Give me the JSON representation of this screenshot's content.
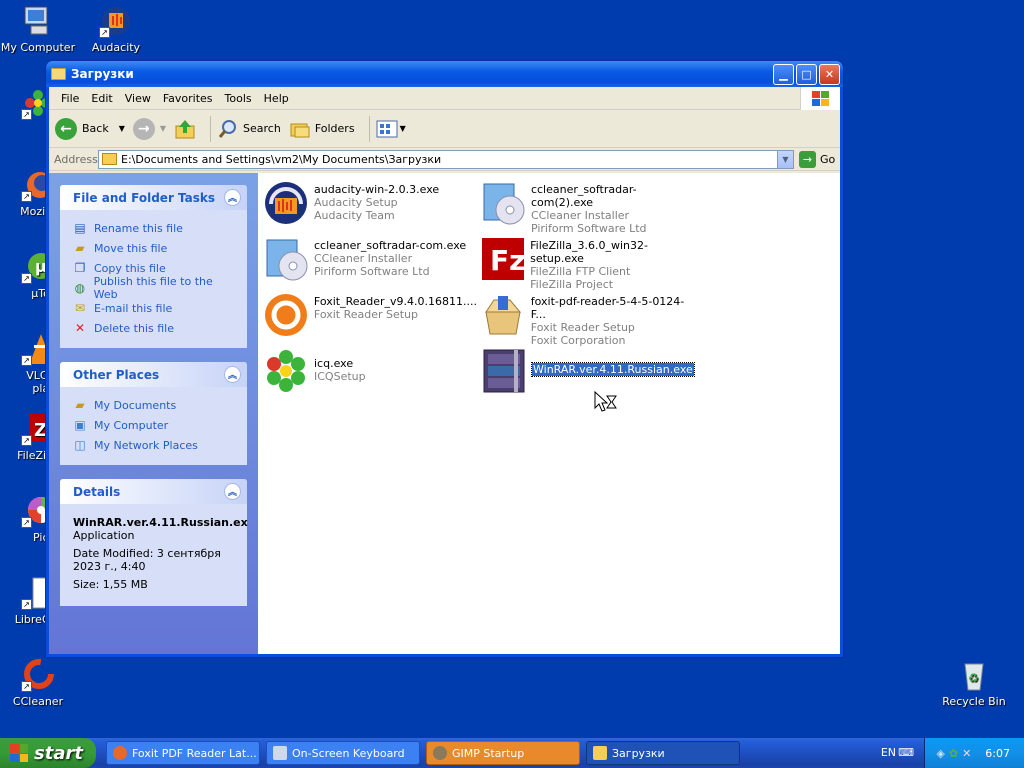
{
  "desktop": {
    "icons": [
      {
        "label": "My Computer"
      },
      {
        "label": "Audacity"
      },
      {
        "label": "ICQ"
      },
      {
        "label": "Mozilla F"
      },
      {
        "label": "µTorr"
      },
      {
        "label": "VLC m"
      },
      {
        "label": "play"
      },
      {
        "label": "FileZilla"
      },
      {
        "label": "Picas"
      },
      {
        "label": "LibreOffi"
      },
      {
        "label": "CCleaner"
      },
      {
        "label": "Recycle Bin"
      }
    ]
  },
  "window": {
    "title": "Загрузки",
    "menu": [
      "File",
      "Edit",
      "View",
      "Favorites",
      "Tools",
      "Help"
    ],
    "toolbar": {
      "back": "Back",
      "search": "Search",
      "folders": "Folders"
    },
    "address": {
      "label": "Address",
      "path": "E:\\Documents and Settings\\vm2\\My Documents\\Загрузки",
      "go": "Go"
    },
    "tasks": {
      "title": "File and Folder Tasks",
      "items": [
        "Rename this file",
        "Move this file",
        "Copy this file",
        "Publish this file to the Web",
        "E-mail this file",
        "Delete this file"
      ]
    },
    "places": {
      "title": "Other Places",
      "items": [
        "My Documents",
        "My Computer",
        "My Network Places"
      ]
    },
    "details": {
      "title": "Details",
      "name": "WinRAR.ver.4.11.Russian.ex",
      "type": "Application",
      "modified": "Date Modified: 3 сентября 2023 г., 4:40",
      "size": "Size: 1,55 MB"
    },
    "files": [
      {
        "name": "audacity-win-2.0.3.exe",
        "desc": "Audacity Setup",
        "company": "Audacity Team"
      },
      {
        "name": "ccleaner_softradar-com(2).exe",
        "desc": "CCleaner Installer",
        "company": "Piriform Software Ltd"
      },
      {
        "name": "ccleaner_softradar-com.exe",
        "desc": "CCleaner Installer",
        "company": "Piriform Software Ltd"
      },
      {
        "name": "FileZilla_3.6.0_win32-setup.exe",
        "desc": "FileZilla FTP Client",
        "company": "FileZilla Project"
      },
      {
        "name": "Foxit_Reader_v9.4.0.16811....",
        "desc": "Foxit Reader Setup",
        "company": ""
      },
      {
        "name": "foxit-pdf-reader-5-4-5-0124-F...",
        "desc": "Foxit Reader Setup",
        "company": "Foxit Corporation"
      },
      {
        "name": "icq.exe",
        "desc": "ICQSetup",
        "company": ""
      },
      {
        "name": "WinRAR.ver.4.11.Russian.exe",
        "desc": "",
        "company": ""
      }
    ]
  },
  "taskbar": {
    "start": "start",
    "tasks": [
      "Foxit PDF Reader Lat...",
      "On-Screen Keyboard",
      "GIMP Startup",
      "Загрузки"
    ],
    "lang": "EN",
    "clock": "6:07"
  }
}
